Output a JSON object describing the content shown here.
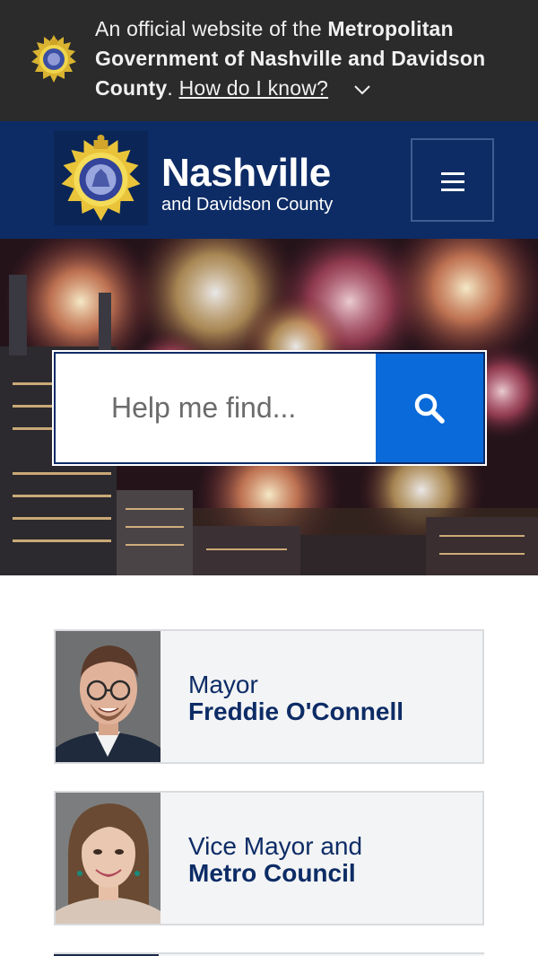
{
  "gov_banner": {
    "text_prefix": "An official website of the ",
    "text_bold": "Metropolitan Government of Nashville and Davidson County",
    "text_suffix": ". ",
    "link_label": "How do I know?"
  },
  "header": {
    "brand_name": "Nashville",
    "brand_sub": "and Davidson County",
    "menu_icon": "hamburger-icon"
  },
  "search": {
    "placeholder": "Help me find...",
    "button_icon": "search-icon"
  },
  "cards": [
    {
      "line1": "Mayor",
      "line2": "Freddie O'Connell"
    },
    {
      "line1": "Vice Mayor and",
      "line2": "Metro Council"
    }
  ],
  "colors": {
    "banner_bg": "#2b2b2b",
    "header_bg": "#0d2c66",
    "search_button": "#0a6ad9",
    "card_bg": "#f3f4f5",
    "card_text": "#0d2c66"
  }
}
